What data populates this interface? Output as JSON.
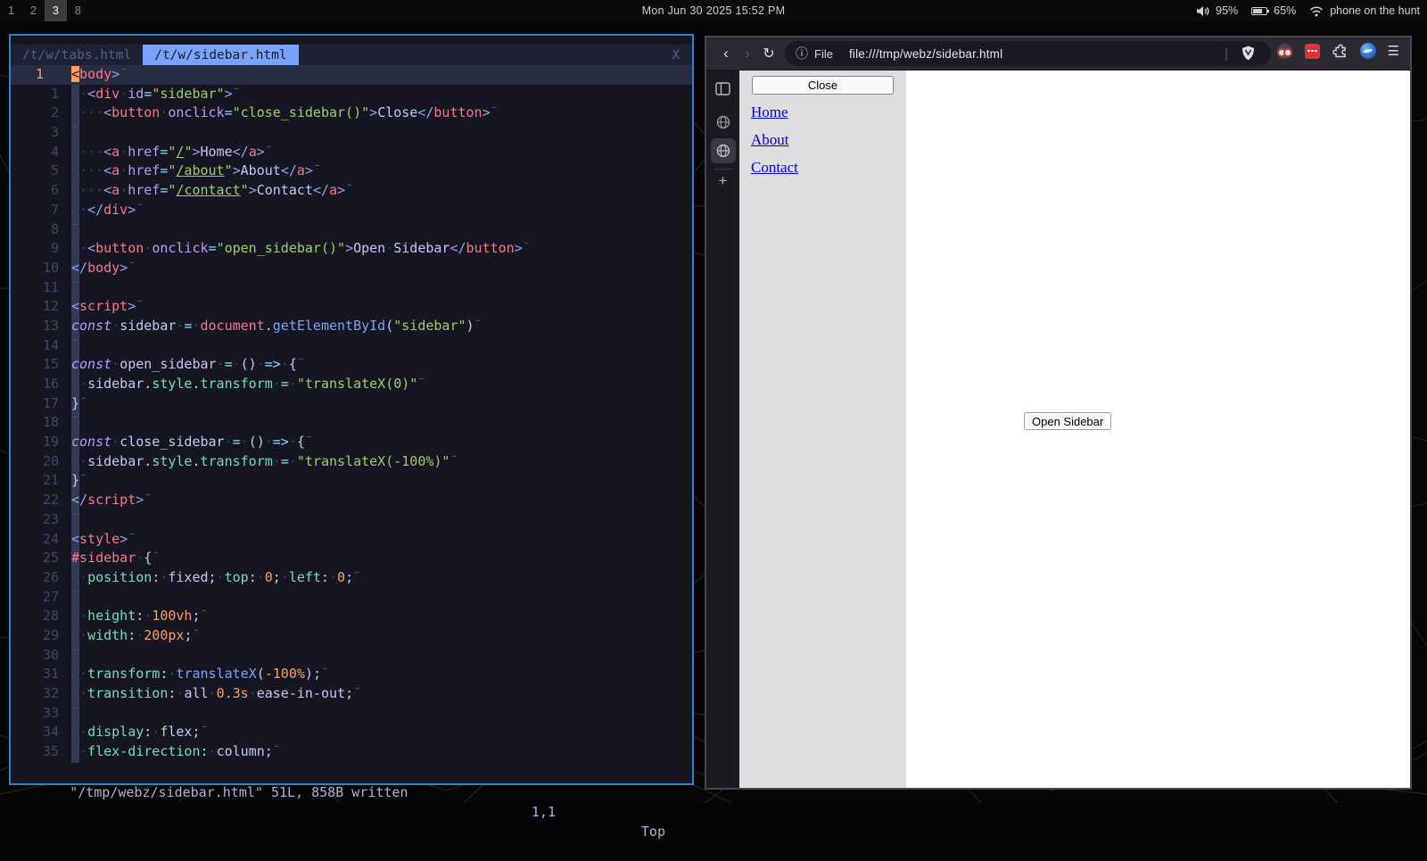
{
  "colors": {
    "focused_window_border": "#2a84c6",
    "editor_bg": "#151621",
    "editor_tab_active_bg": "#7aa2f7",
    "cursor_orange": "#ff9e64",
    "browser_toolbar_bg": "#2b2a33",
    "page_sidebar_bg": "#dedede",
    "link_blue": "#0000ee",
    "string_green": "#9ece6a",
    "tag_red": "#f7768e"
  },
  "topbar": {
    "workspaces": [
      "1",
      "2",
      "3",
      "8"
    ],
    "active_workspace": "3",
    "clock": "Mon Jun 30 2025  15:52 PM",
    "volume_icon": "speaker",
    "volume": "95%",
    "battery_icon": "battery-two-thirds",
    "battery": "65%",
    "wifi_icon": "wifi",
    "wifi_name": "phone on the hunt"
  },
  "editor": {
    "tabs": [
      {
        "label": "/t/w/tabs.html",
        "active": false
      },
      {
        "label": "/t/w/sidebar.html",
        "active": true
      }
    ],
    "close_x": "X",
    "statusline": {
      "left": "\"/tmp/webz/sidebar.html\" 51L, 858B written",
      "ruler": "1,1",
      "position": "Top"
    },
    "lines": [
      {
        "num": "1",
        "cur": true,
        "t": [
          [
            "<",
            "cur"
          ],
          [
            "body",
            "tag"
          ],
          [
            ">",
            "pn"
          ],
          [
            "¯",
            "eol"
          ]
        ]
      },
      {
        "num": "1",
        "t": [
          [
            "··",
            "ws"
          ],
          [
            "<",
            "pn"
          ],
          [
            "div",
            "tag"
          ],
          [
            "·",
            "ws"
          ],
          [
            "id",
            "attr"
          ],
          [
            "=",
            "op"
          ],
          [
            "\"sidebar\"",
            "str"
          ],
          [
            ">",
            "pn"
          ],
          [
            "¯",
            "eol"
          ]
        ]
      },
      {
        "num": "2",
        "t": [
          [
            "····",
            "ws"
          ],
          [
            "<",
            "pn"
          ],
          [
            "button",
            "tag"
          ],
          [
            "·",
            "ws"
          ],
          [
            "onclick",
            "attr"
          ],
          [
            "=",
            "op"
          ],
          [
            "\"close_sidebar()\"",
            "str"
          ],
          [
            ">",
            "pn"
          ],
          [
            "Close",
            "txt"
          ],
          [
            "</",
            "pn"
          ],
          [
            "button",
            "tag"
          ],
          [
            ">",
            "pn"
          ],
          [
            "¯",
            "eol"
          ]
        ]
      },
      {
        "num": "3",
        "t": [
          [
            "¯",
            "eol"
          ]
        ]
      },
      {
        "num": "4",
        "t": [
          [
            "····",
            "ws"
          ],
          [
            "<",
            "pn"
          ],
          [
            "a",
            "tag"
          ],
          [
            "·",
            "ws"
          ],
          [
            "href",
            "attr"
          ],
          [
            "=",
            "op"
          ],
          [
            "\"",
            "str"
          ],
          [
            "/",
            "url"
          ],
          [
            "\"",
            "str"
          ],
          [
            ">",
            "pn"
          ],
          [
            "Home",
            "txt"
          ],
          [
            "</",
            "pn"
          ],
          [
            "a",
            "tag"
          ],
          [
            ">",
            "pn"
          ],
          [
            "¯",
            "eol"
          ]
        ]
      },
      {
        "num": "5",
        "t": [
          [
            "····",
            "ws"
          ],
          [
            "<",
            "pn"
          ],
          [
            "a",
            "tag"
          ],
          [
            "·",
            "ws"
          ],
          [
            "href",
            "attr"
          ],
          [
            "=",
            "op"
          ],
          [
            "\"",
            "str"
          ],
          [
            "/about",
            "url"
          ],
          [
            "\"",
            "str"
          ],
          [
            ">",
            "pn"
          ],
          [
            "About",
            "txt"
          ],
          [
            "</",
            "pn"
          ],
          [
            "a",
            "tag"
          ],
          [
            ">",
            "pn"
          ],
          [
            "¯",
            "eol"
          ]
        ]
      },
      {
        "num": "6",
        "t": [
          [
            "····",
            "ws"
          ],
          [
            "<",
            "pn"
          ],
          [
            "a",
            "tag"
          ],
          [
            "·",
            "ws"
          ],
          [
            "href",
            "attr"
          ],
          [
            "=",
            "op"
          ],
          [
            "\"",
            "str"
          ],
          [
            "/contact",
            "url"
          ],
          [
            "\"",
            "str"
          ],
          [
            ">",
            "pn"
          ],
          [
            "Contact",
            "txt"
          ],
          [
            "</",
            "pn"
          ],
          [
            "a",
            "tag"
          ],
          [
            ">",
            "pn"
          ],
          [
            "¯",
            "eol"
          ]
        ]
      },
      {
        "num": "7",
        "t": [
          [
            "··",
            "ws"
          ],
          [
            "</",
            "pn"
          ],
          [
            "div",
            "tag"
          ],
          [
            ">",
            "pn"
          ],
          [
            "¯",
            "eol"
          ]
        ]
      },
      {
        "num": "8",
        "t": [
          [
            "¯",
            "eol"
          ]
        ]
      },
      {
        "num": "9",
        "t": [
          [
            "··",
            "ws"
          ],
          [
            "<",
            "pn"
          ],
          [
            "button",
            "tag"
          ],
          [
            "·",
            "ws"
          ],
          [
            "onclick",
            "attr"
          ],
          [
            "=",
            "op"
          ],
          [
            "\"open_sidebar()\"",
            "str"
          ],
          [
            ">",
            "pn"
          ],
          [
            "Open",
            "txt"
          ],
          [
            "·",
            "ws"
          ],
          [
            "Sidebar",
            "txt"
          ],
          [
            "</",
            "pn"
          ],
          [
            "button",
            "tag"
          ],
          [
            ">",
            "pn"
          ],
          [
            "¯",
            "eol"
          ]
        ]
      },
      {
        "num": "10",
        "t": [
          [
            "</",
            "pn"
          ],
          [
            "body",
            "tag"
          ],
          [
            ">",
            "pn"
          ],
          [
            "¯",
            "eol"
          ]
        ]
      },
      {
        "num": "11",
        "t": [
          [
            "¯",
            "eol"
          ]
        ]
      },
      {
        "num": "12",
        "t": [
          [
            "<",
            "pn"
          ],
          [
            "script",
            "tag"
          ],
          [
            ">",
            "pn"
          ],
          [
            "¯",
            "eol"
          ]
        ]
      },
      {
        "num": "13",
        "t": [
          [
            "const",
            "kw"
          ],
          [
            "·",
            "ws"
          ],
          [
            "sidebar",
            "var"
          ],
          [
            "·",
            "ws"
          ],
          [
            "=",
            "op"
          ],
          [
            "·",
            "ws"
          ],
          [
            "document",
            "builtin"
          ],
          [
            ".",
            "var"
          ],
          [
            "getElementById",
            "fn"
          ],
          [
            "(",
            "var"
          ],
          [
            "\"sidebar\"",
            "str"
          ],
          [
            ")",
            "var"
          ],
          [
            "¯",
            "eol"
          ]
        ]
      },
      {
        "num": "14",
        "t": [
          [
            "¯",
            "eol"
          ]
        ]
      },
      {
        "num": "15",
        "t": [
          [
            "const",
            "kw"
          ],
          [
            "·",
            "ws"
          ],
          [
            "open_sidebar",
            "var"
          ],
          [
            "·",
            "ws"
          ],
          [
            "=",
            "op"
          ],
          [
            "·",
            "ws"
          ],
          [
            "()",
            "var"
          ],
          [
            "·",
            "ws"
          ],
          [
            "=>",
            "op"
          ],
          [
            "·",
            "ws"
          ],
          [
            "{",
            "var"
          ],
          [
            "¯",
            "eol"
          ]
        ]
      },
      {
        "num": "16",
        "t": [
          [
            "··",
            "ws"
          ],
          [
            "sidebar",
            "var"
          ],
          [
            ".",
            "var"
          ],
          [
            "style",
            "prop"
          ],
          [
            ".",
            "var"
          ],
          [
            "transform",
            "prop"
          ],
          [
            "·",
            "ws"
          ],
          [
            "=",
            "op"
          ],
          [
            "·",
            "ws"
          ],
          [
            "\"translateX(0)\"",
            "str"
          ],
          [
            "¯",
            "eol"
          ]
        ]
      },
      {
        "num": "17",
        "t": [
          [
            "}",
            "var"
          ],
          [
            "¯",
            "eol"
          ]
        ]
      },
      {
        "num": "18",
        "t": [
          [
            "¯",
            "eol"
          ]
        ]
      },
      {
        "num": "19",
        "t": [
          [
            "const",
            "kw"
          ],
          [
            "·",
            "ws"
          ],
          [
            "close_sidebar",
            "var"
          ],
          [
            "·",
            "ws"
          ],
          [
            "=",
            "op"
          ],
          [
            "·",
            "ws"
          ],
          [
            "()",
            "var"
          ],
          [
            "·",
            "ws"
          ],
          [
            "=>",
            "op"
          ],
          [
            "·",
            "ws"
          ],
          [
            "{",
            "var"
          ],
          [
            "¯",
            "eol"
          ]
        ]
      },
      {
        "num": "20",
        "t": [
          [
            "··",
            "ws"
          ],
          [
            "sidebar",
            "var"
          ],
          [
            ".",
            "var"
          ],
          [
            "style",
            "prop"
          ],
          [
            ".",
            "var"
          ],
          [
            "transform",
            "prop"
          ],
          [
            "·",
            "ws"
          ],
          [
            "=",
            "op"
          ],
          [
            "·",
            "ws"
          ],
          [
            "\"translateX(-100%)\"",
            "str"
          ],
          [
            "¯",
            "eol"
          ]
        ]
      },
      {
        "num": "21",
        "t": [
          [
            "}",
            "var"
          ],
          [
            "¯",
            "eol"
          ]
        ]
      },
      {
        "num": "22",
        "t": [
          [
            "</",
            "pn"
          ],
          [
            "script",
            "tag"
          ],
          [
            ">",
            "pn"
          ],
          [
            "¯",
            "eol"
          ]
        ]
      },
      {
        "num": "23",
        "t": [
          [
            "¯",
            "eol"
          ]
        ]
      },
      {
        "num": "24",
        "t": [
          [
            "<",
            "pn"
          ],
          [
            "style",
            "tag"
          ],
          [
            ">",
            "pn"
          ],
          [
            "¯",
            "eol"
          ]
        ]
      },
      {
        "num": "25",
        "t": [
          [
            "#sidebar",
            "tag"
          ],
          [
            "·",
            "ws"
          ],
          [
            "{",
            "var"
          ],
          [
            "¯",
            "eol"
          ]
        ]
      },
      {
        "num": "26",
        "t": [
          [
            "··",
            "ws"
          ],
          [
            "position",
            "prop"
          ],
          [
            ":",
            "var"
          ],
          [
            "·",
            "ws"
          ],
          [
            "fixed",
            "var"
          ],
          [
            ";",
            "var"
          ],
          [
            "·",
            "ws"
          ],
          [
            "top",
            "prop"
          ],
          [
            ":",
            "var"
          ],
          [
            "·",
            "ws"
          ],
          [
            "0",
            "num"
          ],
          [
            ";",
            "var"
          ],
          [
            "·",
            "ws"
          ],
          [
            "left",
            "prop"
          ],
          [
            ":",
            "var"
          ],
          [
            "·",
            "ws"
          ],
          [
            "0",
            "num"
          ],
          [
            ";",
            "var"
          ],
          [
            "¯",
            "eol"
          ]
        ]
      },
      {
        "num": "27",
        "t": [
          [
            "¯",
            "eol"
          ]
        ]
      },
      {
        "num": "28",
        "t": [
          [
            "··",
            "ws"
          ],
          [
            "height",
            "prop"
          ],
          [
            ":",
            "var"
          ],
          [
            "·",
            "ws"
          ],
          [
            "100vh",
            "num"
          ],
          [
            ";",
            "var"
          ],
          [
            "¯",
            "eol"
          ]
        ]
      },
      {
        "num": "29",
        "t": [
          [
            "··",
            "ws"
          ],
          [
            "width",
            "prop"
          ],
          [
            ":",
            "var"
          ],
          [
            "·",
            "ws"
          ],
          [
            "200px",
            "num"
          ],
          [
            ";",
            "var"
          ],
          [
            "¯",
            "eol"
          ]
        ]
      },
      {
        "num": "30",
        "t": [
          [
            "¯",
            "eol"
          ]
        ]
      },
      {
        "num": "31",
        "t": [
          [
            "··",
            "ws"
          ],
          [
            "transform",
            "prop"
          ],
          [
            ":",
            "var"
          ],
          [
            "·",
            "ws"
          ],
          [
            "translateX",
            "fn"
          ],
          [
            "(",
            "var"
          ],
          [
            "-100%",
            "num"
          ],
          [
            ")",
            "var"
          ],
          [
            ";",
            "var"
          ],
          [
            "¯",
            "eol"
          ]
        ]
      },
      {
        "num": "32",
        "t": [
          [
            "··",
            "ws"
          ],
          [
            "transition",
            "prop"
          ],
          [
            ":",
            "var"
          ],
          [
            "·",
            "ws"
          ],
          [
            "all",
            "var"
          ],
          [
            "·",
            "ws"
          ],
          [
            "0.3s",
            "num"
          ],
          [
            "·",
            "ws"
          ],
          [
            "ease-in-out",
            "var"
          ],
          [
            ";",
            "var"
          ],
          [
            "¯",
            "eol"
          ]
        ]
      },
      {
        "num": "33",
        "t": [
          [
            "¯",
            "eol"
          ]
        ]
      },
      {
        "num": "34",
        "t": [
          [
            "··",
            "ws"
          ],
          [
            "display",
            "prop"
          ],
          [
            ":",
            "var"
          ],
          [
            "·",
            "ws"
          ],
          [
            "flex",
            "var"
          ],
          [
            ";",
            "var"
          ],
          [
            "¯",
            "eol"
          ]
        ]
      },
      {
        "num": "35",
        "t": [
          [
            "··",
            "ws"
          ],
          [
            "flex-direction",
            "prop"
          ],
          [
            ":",
            "var"
          ],
          [
            "·",
            "ws"
          ],
          [
            "column",
            "var"
          ],
          [
            ";",
            "var"
          ],
          [
            "¯",
            "eol"
          ]
        ]
      }
    ]
  },
  "browser": {
    "toolbar": {
      "back": "‹",
      "forward": "›",
      "reload": "↻",
      "info_icon": "ⓘ",
      "url_chip": "File",
      "url": "file:///tmp/webz/sidebar.html",
      "separator": "|",
      "menu": "☰"
    },
    "tabstrip": {
      "new_tab": "+"
    },
    "page": {
      "close_label": "Close",
      "links": [
        "Home",
        "About",
        "Contact"
      ],
      "open_label": "Open Sidebar"
    }
  }
}
